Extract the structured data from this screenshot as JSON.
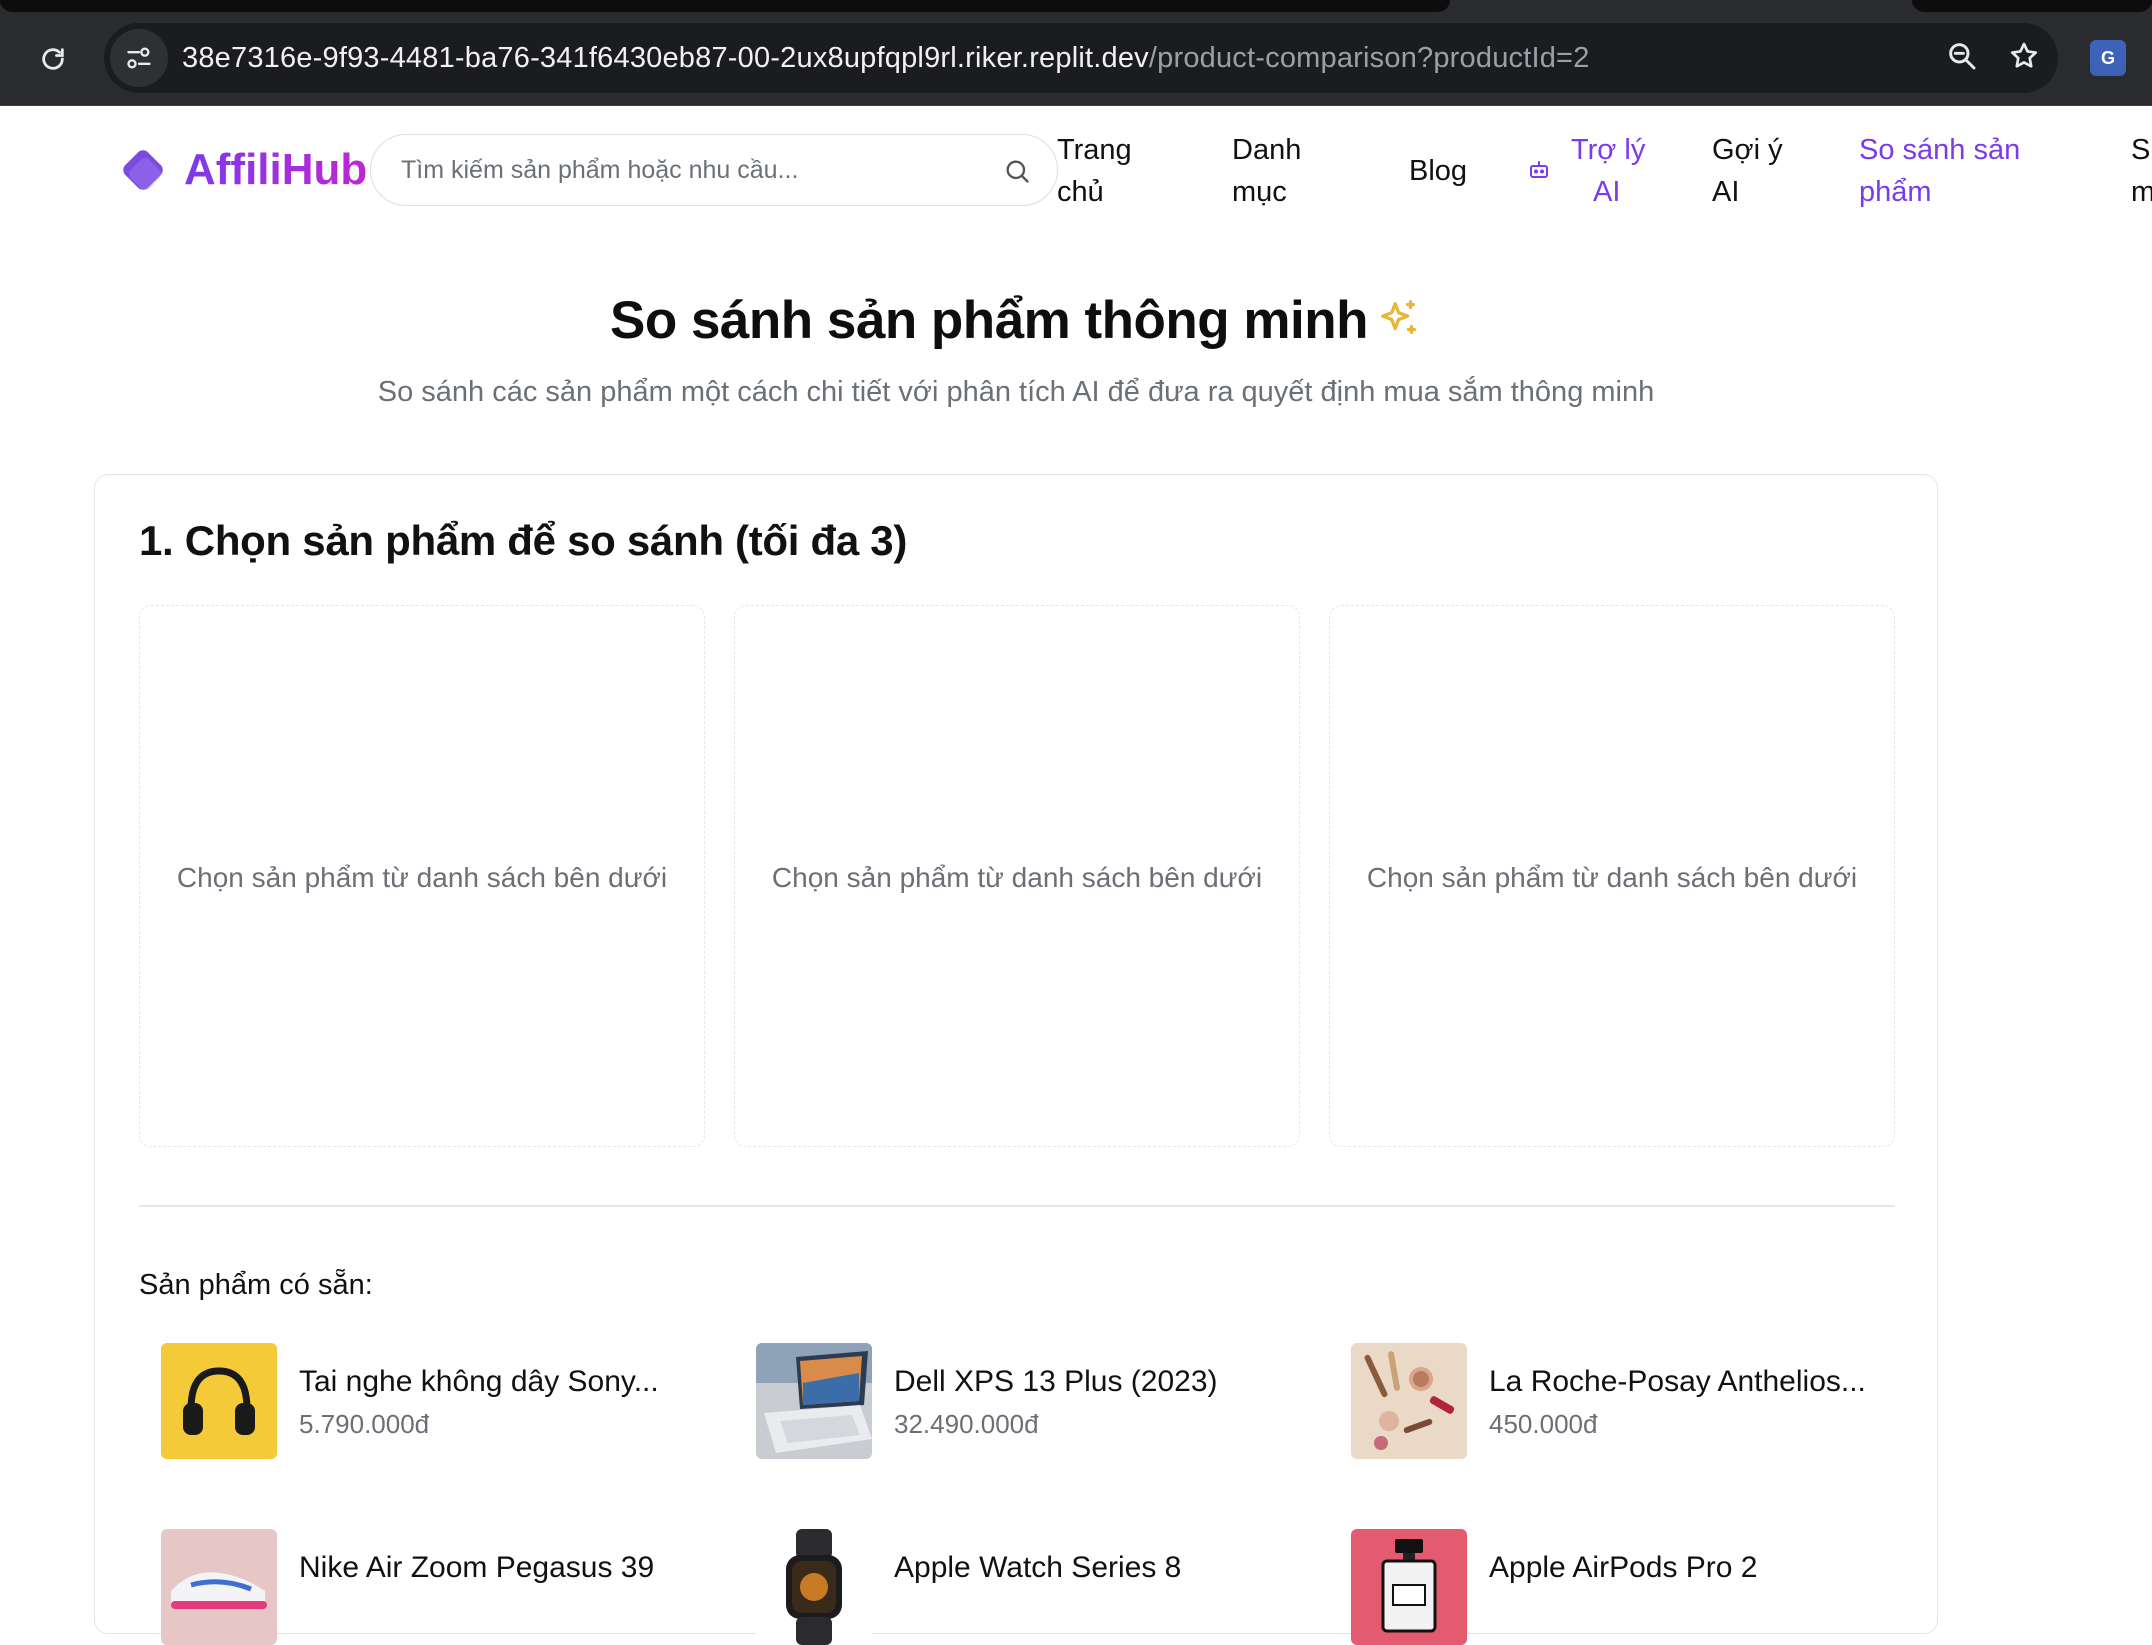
{
  "browser": {
    "url_host": "38e7316e-9f93-4481-ba76-341f6430eb87-00-2ux8upfqpl9rl.riker.replit.dev",
    "url_path": "/product-comparison?productId=2",
    "icons": [
      "reload-icon",
      "site-info-icon",
      "zoom-icon",
      "bookmark-star-icon",
      "translate-extension-icon"
    ]
  },
  "header": {
    "logo_text": "AffiliHub",
    "search_placeholder": "Tìm kiếm sản phẩm hoặc nhu cầu...",
    "nav": {
      "home": [
        "Trang",
        "chủ"
      ],
      "categories": [
        "Danh",
        "mục"
      ],
      "blog": "Blog",
      "assistant": [
        "Trợ lý",
        "AI"
      ],
      "suggest": [
        "Gợi ý",
        "AI"
      ],
      "compare": [
        "So sánh sản",
        "phẩm"
      ],
      "cut_off": [
        "S",
        "m"
      ]
    }
  },
  "hero": {
    "title": "So sánh sản phẩm thông minh",
    "subtitle": "So sánh các sản phẩm một cách chi tiết với phân tích AI để đưa ra quyết định mua sắm thông minh"
  },
  "selection": {
    "title": "1. Chọn sản phẩm để so sánh (tối đa 3)",
    "slots": [
      "Chọn sản phẩm từ danh sách bên dưới",
      "Chọn sản phẩm từ danh sách bên dưới",
      "Chọn sản phẩm từ danh sách bên dưới"
    ],
    "available_label": "Sản phẩm có sẵn:",
    "products": [
      {
        "name": "Tai nghe không dây Sony...",
        "price": "5.790.000đ"
      },
      {
        "name": "Dell XPS 13 Plus (2023)",
        "price": "32.490.000đ"
      },
      {
        "name": "La Roche-Posay Anthelios...",
        "price": "450.000đ"
      },
      {
        "name": "Nike Air Zoom Pegasus 39",
        "price": ""
      },
      {
        "name": "Apple Watch Series 8",
        "price": ""
      },
      {
        "name": "Apple AirPods Pro 2",
        "price": ""
      }
    ]
  },
  "colors": {
    "accent": "#7c3aed",
    "sparkle": "#e8b43a",
    "muted_text": "#6b6f76"
  }
}
